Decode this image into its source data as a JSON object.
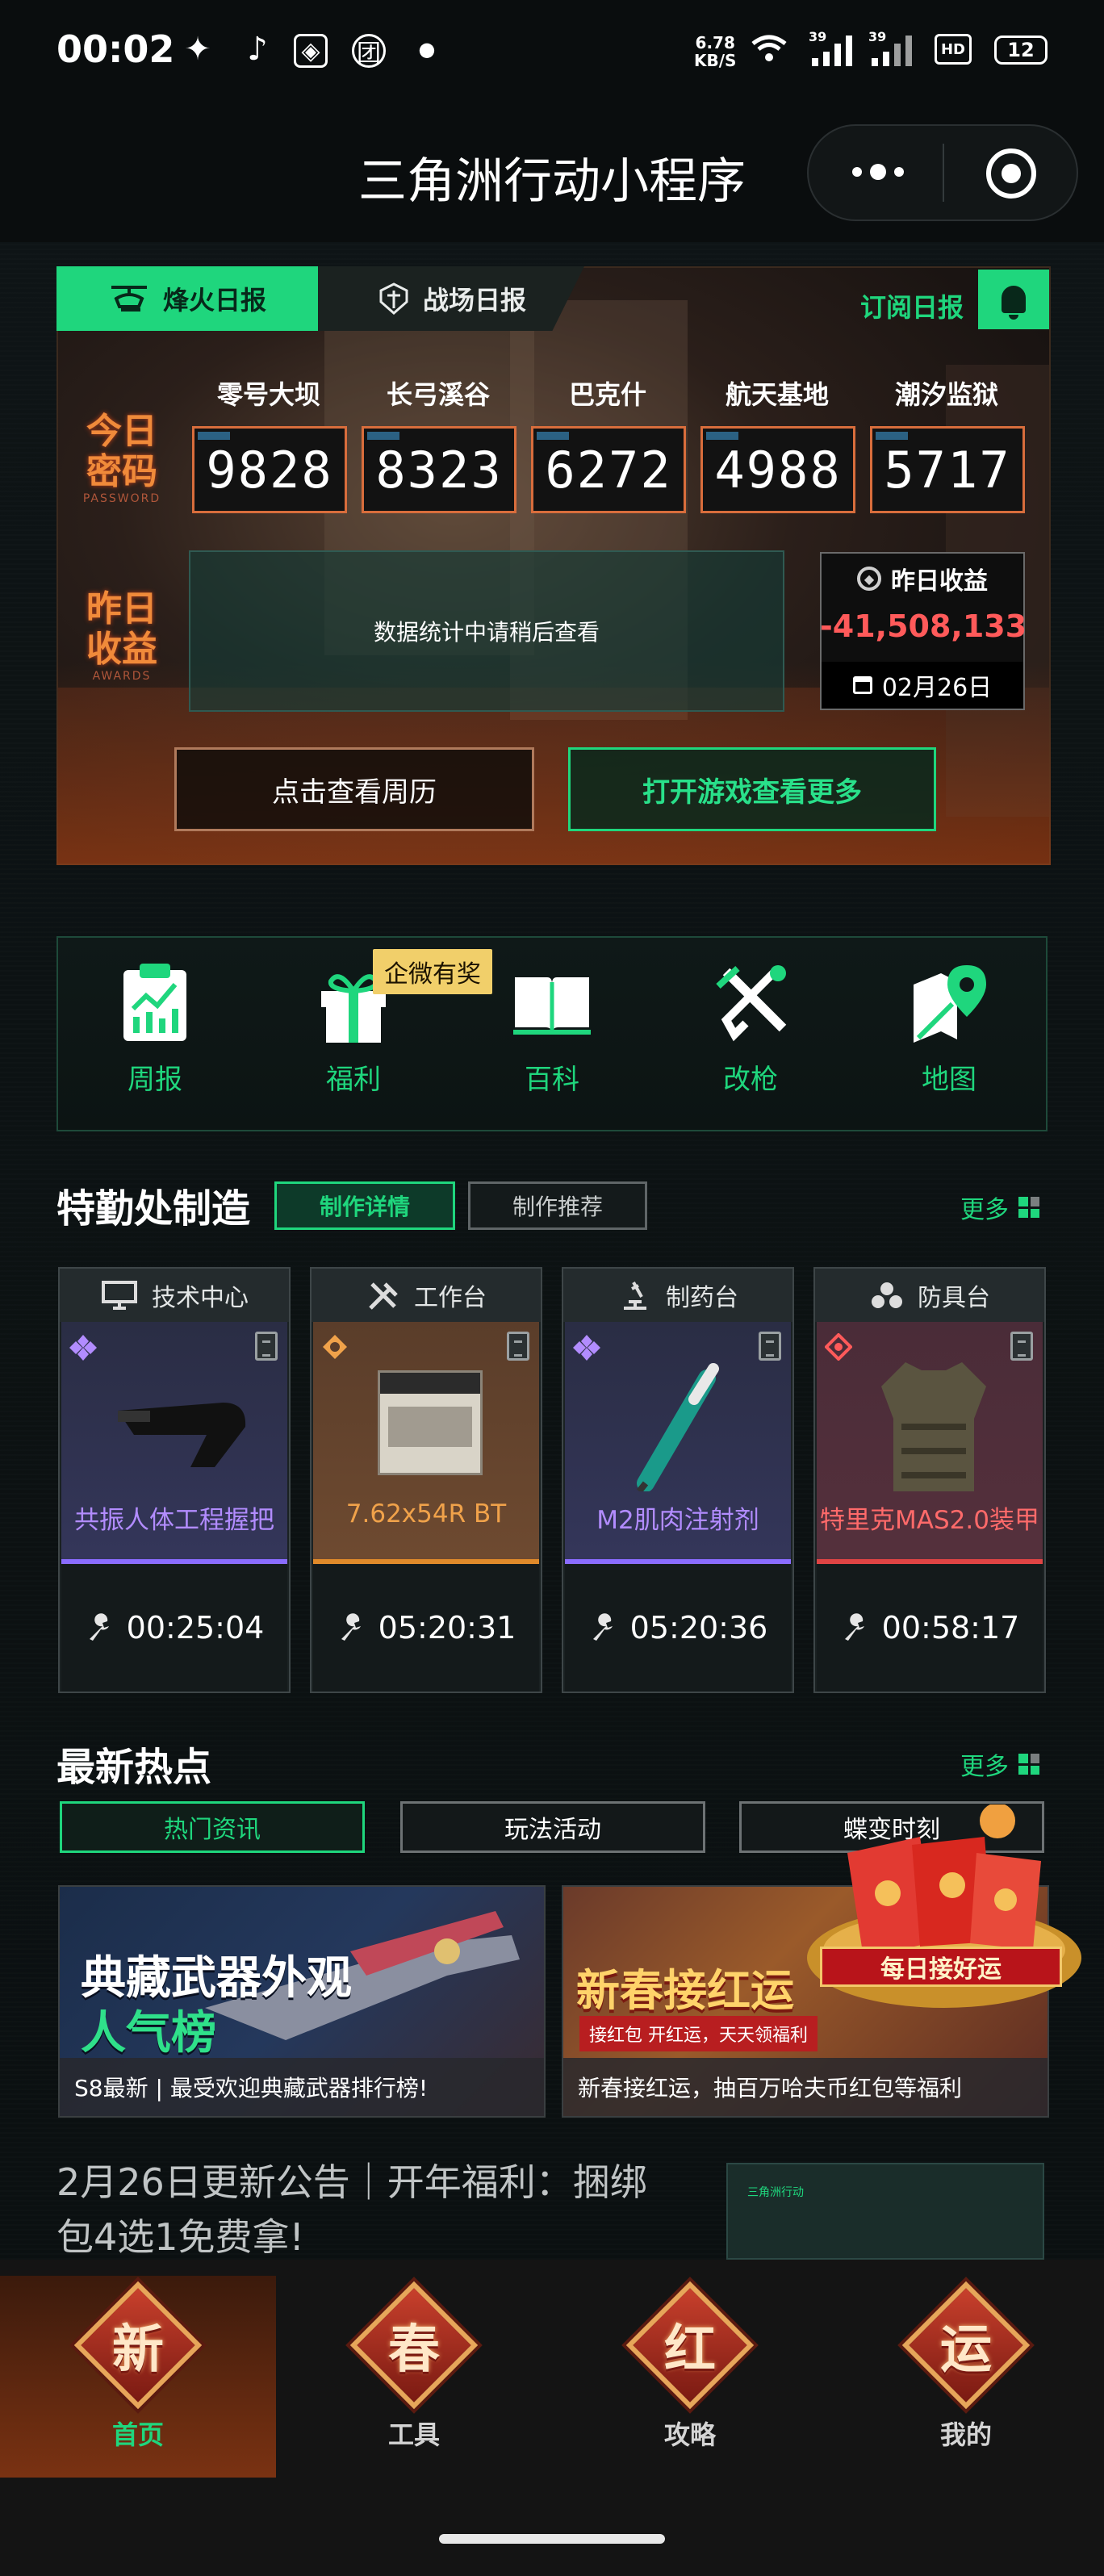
{
  "status_bar": {
    "time": "00:02",
    "net_speed_top": "6.78",
    "net_speed_bottom": "KB/S",
    "signal1": "39",
    "signal2": "39",
    "hd": "HD",
    "battery": "12"
  },
  "title_bar": {
    "title": "三角洲行动小程序"
  },
  "daily": {
    "tab_active": "烽火日报",
    "tab_inactive": "战场日报",
    "subscribe": "订阅日报",
    "today_label": "今日\n密码",
    "today_sub": "PASSWORD",
    "yesterday_label": "昨日\n收益",
    "yesterday_sub": "AWARDS",
    "maps": [
      {
        "name": "零号大坝",
        "code": "9828"
      },
      {
        "name": "长弓溪谷",
        "code": "8323"
      },
      {
        "name": "巴克什",
        "code": "6272"
      },
      {
        "name": "航天基地",
        "code": "4988"
      },
      {
        "name": "潮汐监狱",
        "code": "5717"
      }
    ],
    "stats_message": "数据统计中请稍后查看",
    "income_title": "昨日收益",
    "income_value": "-41,508,133",
    "income_date": "02月26日",
    "btn_calendar": "点击查看周历",
    "btn_open_game": "打开游戏查看更多"
  },
  "tools": {
    "prize_tag": "企微有奖",
    "items": [
      {
        "label": "周报",
        "icon": "clipboard-chart-icon"
      },
      {
        "label": "福利",
        "icon": "gift-icon"
      },
      {
        "label": "百科",
        "icon": "book-icon"
      },
      {
        "label": "改枪",
        "icon": "gun-wrench-icon"
      },
      {
        "label": "地图",
        "icon": "map-pin-icon"
      }
    ]
  },
  "crafting": {
    "title": "特勤处制造",
    "chip_active": "制作详情",
    "chip": "制作推荐",
    "more": "更多",
    "cards": [
      {
        "station": "技术中心",
        "item": "共振人体工程握把",
        "timer": "00:25:04",
        "color": "#b28cff"
      },
      {
        "station": "工作台",
        "item": "7.62x54R BT",
        "timer": "05:20:31",
        "color": "#f0a24a"
      },
      {
        "station": "制药台",
        "item": "M2肌肉注射剂",
        "timer": "05:20:36",
        "color": "#b28cff"
      },
      {
        "station": "防具台",
        "item": "特里克MAS2.0装甲",
        "timer": "00:58:17",
        "color": "#ff5a5a"
      }
    ]
  },
  "hot": {
    "title": "最新热点",
    "more": "更多",
    "tabs": [
      "热门资讯",
      "玩法活动",
      "蝶变时刻"
    ],
    "banners": [
      {
        "headline1": "典藏武器外观",
        "headline2": "人气榜",
        "caption": "S8最新 | 最受欢迎典藏武器排行榜!"
      },
      {
        "headline1": "新春接红运",
        "badge": "每日接好运",
        "subline": "接红包 开红运，天天领福利",
        "caption": "新春接红运，抽百万哈夫币红包等福利"
      }
    ],
    "notice": "2月26日更新公告｜开年福利：捆绑包4选1免费拿!",
    "notice_thumb_label": "三角洲行动"
  },
  "bottom_nav": [
    {
      "glyph": "新",
      "label": "首页"
    },
    {
      "glyph": "春",
      "label": "工具"
    },
    {
      "glyph": "红",
      "label": "攻略"
    },
    {
      "glyph": "运",
      "label": "我的"
    }
  ]
}
